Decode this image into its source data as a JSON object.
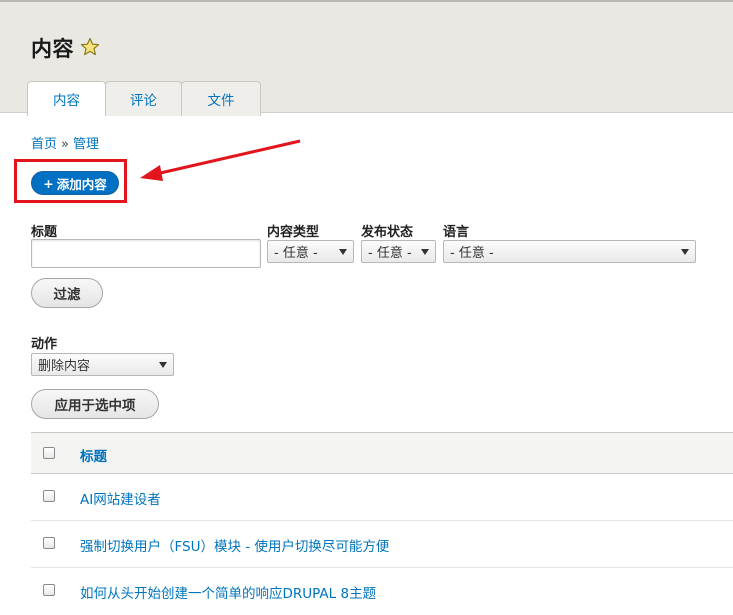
{
  "header": {
    "title": "内容",
    "tabs": [
      {
        "label": "内容",
        "active": true
      },
      {
        "label": "评论",
        "active": false
      },
      {
        "label": "文件",
        "active": false
      }
    ]
  },
  "breadcrumb": {
    "items": [
      "首页",
      "管理"
    ],
    "separator": "»"
  },
  "add_button": {
    "icon": "+",
    "label": "添加内容"
  },
  "filters": {
    "title_label": "标题",
    "title_value": "",
    "type_label": "内容类型",
    "type_value": "- 任意 -",
    "status_label": "发布状态",
    "status_value": "- 任意 -",
    "language_label": "语言",
    "language_value": "- 任意 -",
    "filter_button": "过滤"
  },
  "actions": {
    "label": "动作",
    "selected": "删除内容",
    "apply_button": "应用于选中项"
  },
  "table": {
    "header": "标题",
    "rows": [
      "AI网站建设者",
      "强制切换用户（FSU）模块 - 使用户切换尽可能方便",
      "如何从头开始创建一个简单的响应DRUPAL 8主题"
    ]
  },
  "colors": {
    "accent": "#0071c2",
    "link": "#0074bd",
    "annotation": "#e2141c",
    "header_bg": "#e9e8e3"
  }
}
